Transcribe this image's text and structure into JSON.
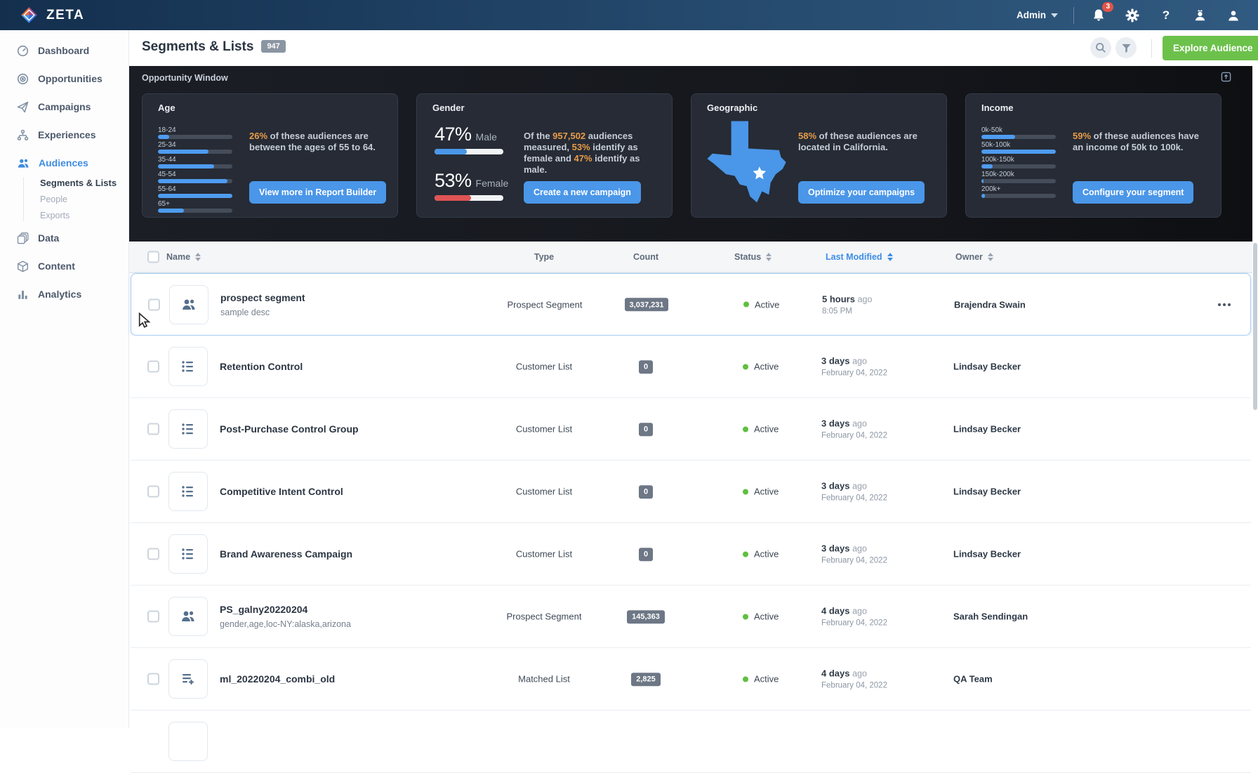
{
  "nav": {
    "brand": "ZETA",
    "user_menu_label": "Admin",
    "notification_count": "3",
    "help_glyph": "?"
  },
  "sidebar": {
    "items": [
      {
        "label": "Dashboard"
      },
      {
        "label": "Opportunities"
      },
      {
        "label": "Campaigns"
      },
      {
        "label": "Experiences"
      },
      {
        "label": "Audiences"
      },
      {
        "label": "Data"
      },
      {
        "label": "Content"
      },
      {
        "label": "Analytics"
      }
    ],
    "audiences_children": [
      {
        "label": "Segments & Lists"
      },
      {
        "label": "People"
      },
      {
        "label": "Exports"
      }
    ]
  },
  "header": {
    "title": "Segments & Lists",
    "count_badge": "947",
    "explore_button": "Explore Audience"
  },
  "opportunity": {
    "title": "Opportunity Window",
    "age": {
      "title": "Age",
      "bars": [
        {
          "label": "18-24",
          "value": 15
        },
        {
          "label": "25-34",
          "value": 68
        },
        {
          "label": "35-44",
          "value": 75
        },
        {
          "label": "45-54",
          "value": 93
        },
        {
          "label": "55-64",
          "value": 100
        },
        {
          "label": "65+",
          "value": 35
        }
      ],
      "highlight": "26%",
      "text": " of these audiences are between the ages of 55 to 64.",
      "button": "View more in Report Builder"
    },
    "gender": {
      "title": "Gender",
      "male_pct": "47%",
      "male_label": "Male",
      "male_value": 47,
      "female_pct": "53%",
      "female_label": "Female",
      "female_value": 53,
      "text_parts": {
        "p1": "Of the ",
        "n1": "957,502",
        "p2": " audiences measured, ",
        "n2": "53%",
        "p3": " identify as female and ",
        "n3": "47%",
        "p4": " identify as male."
      },
      "button": "Create a new campaign"
    },
    "geographic": {
      "title": "Geographic",
      "highlight": "58%",
      "text": " of these audiences are located in California.",
      "button": "Optimize your campaigns"
    },
    "income": {
      "title": "Income",
      "bars": [
        {
          "label": "0k-50k",
          "value": 45
        },
        {
          "label": "50k-100k",
          "value": 100
        },
        {
          "label": "100k-150k",
          "value": 15
        },
        {
          "label": "150k-200k",
          "value": 3
        },
        {
          "label": "200k+",
          "value": 5
        }
      ],
      "highlight": "59%",
      "text": " of these audiences have an income of 50k to 100k.",
      "button": "Configure your segment"
    }
  },
  "table": {
    "columns": {
      "name": "Name",
      "type": "Type",
      "count": "Count",
      "status": "Status",
      "last_modified": "Last Modified",
      "owner": "Owner"
    },
    "rows": [
      {
        "name": "prospect segment",
        "desc": "sample desc",
        "icon": "people-icon",
        "type": "Prospect Segment",
        "count": "3,037,231",
        "status": "Active",
        "modified": "5 hours",
        "modified_suffix": "ago",
        "modified_sub": "8:05 PM",
        "owner": "Brajendra Swain"
      },
      {
        "name": "Retention Control",
        "desc": "",
        "icon": "list-icon",
        "type": "Customer List",
        "count": "0",
        "status": "Active",
        "modified": "3 days",
        "modified_suffix": "ago",
        "modified_sub": "February 04, 2022",
        "owner": "Lindsay Becker"
      },
      {
        "name": "Post-Purchase Control Group",
        "desc": "",
        "icon": "list-icon",
        "type": "Customer List",
        "count": "0",
        "status": "Active",
        "modified": "3 days",
        "modified_suffix": "ago",
        "modified_sub": "February 04, 2022",
        "owner": "Lindsay Becker"
      },
      {
        "name": "Competitive Intent Control",
        "desc": "",
        "icon": "list-icon",
        "type": "Customer List",
        "count": "0",
        "status": "Active",
        "modified": "3 days",
        "modified_suffix": "ago",
        "modified_sub": "February 04, 2022",
        "owner": "Lindsay Becker"
      },
      {
        "name": "Brand Awareness Campaign",
        "desc": "",
        "icon": "list-icon",
        "type": "Customer List",
        "count": "0",
        "status": "Active",
        "modified": "3 days",
        "modified_suffix": "ago",
        "modified_sub": "February 04, 2022",
        "owner": "Lindsay Becker"
      },
      {
        "name": "PS_galny20220204",
        "desc": "gender,age,loc-NY:alaska,arizona",
        "icon": "people-icon",
        "type": "Prospect Segment",
        "count": "145,363",
        "status": "Active",
        "modified": "4 days",
        "modified_suffix": "ago",
        "modified_sub": "February 04, 2022",
        "owner": "Sarah Sendingan"
      },
      {
        "name": "ml_20220204_combi_old",
        "desc": "",
        "icon": "matched-list-icon",
        "type": "Matched List",
        "count": "2,825",
        "status": "Active",
        "modified": "4 days",
        "modified_suffix": "ago",
        "modified_sub": "February 04, 2022",
        "owner": "QA Team"
      }
    ]
  }
}
